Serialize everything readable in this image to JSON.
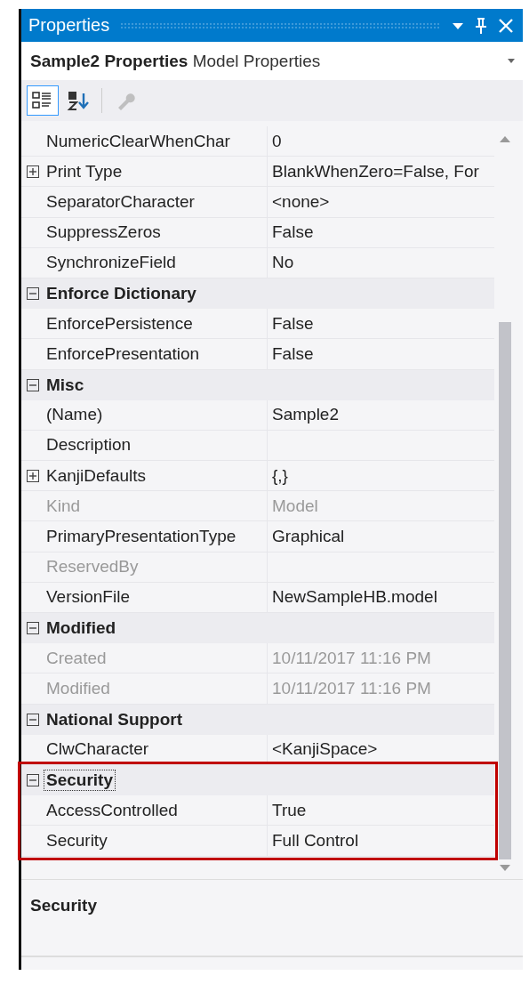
{
  "window": {
    "title": "Properties"
  },
  "object_selector": {
    "text": "**Sample2 Properties** Model Properties"
  },
  "toolbar": [
    {
      "kind": "categorized",
      "selected": true,
      "disabled": false
    },
    {
      "kind": "alphabetical",
      "selected": false,
      "disabled": false
    },
    {
      "kind": "property-pages",
      "selected": false,
      "disabled": true
    }
  ],
  "grid": {
    "sections": [
      {
        "properties": [
          {
            "name": "NumericClearWhenChar",
            "value": "0",
            "disabled": false
          },
          {
            "name": "Print Type",
            "value": "BlankWhenZero=False, For",
            "disabled": false,
            "expanded": false
          },
          {
            "name": "SeparatorCharacter",
            "value": "<none>",
            "disabled": false
          },
          {
            "name": "SuppressZeros",
            "value": "False",
            "disabled": false
          },
          {
            "name": "SynchronizeField",
            "value": "No",
            "disabled": false
          }
        ]
      },
      {
        "name": "Enforce Dictionary",
        "expanded": true,
        "selected": false,
        "highlighted": false,
        "properties": [
          {
            "name": "EnforcePersistence",
            "value": "False",
            "disabled": false
          },
          {
            "name": "EnforcePresentation",
            "value": "False",
            "disabled": false
          }
        ]
      },
      {
        "name": "Misc",
        "expanded": true,
        "selected": false,
        "highlighted": false,
        "properties": [
          {
            "name": "(Name)",
            "value": "Sample2",
            "disabled": false
          },
          {
            "name": "Description",
            "disabled": false
          },
          {
            "name": "KanjiDefaults",
            "value": "{,}",
            "disabled": false,
            "expanded": false
          },
          {
            "name": "Kind",
            "value": "Model",
            "disabled": true
          },
          {
            "name": "PrimaryPresentationType",
            "value": "Graphical",
            "disabled": false
          },
          {
            "name": "ReservedBy",
            "disabled": true
          },
          {
            "name": "VersionFile",
            "value": "NewSampleHB.model",
            "disabled": false
          }
        ]
      },
      {
        "name": "Modified",
        "expanded": true,
        "selected": false,
        "highlighted": false,
        "properties": [
          {
            "name": "Created",
            "value": "10/11/2017 11:16 PM",
            "disabled": true
          },
          {
            "name": "Modified",
            "value": "10/11/2017 11:16 PM",
            "disabled": true
          }
        ]
      },
      {
        "name": "National Support",
        "expanded": true,
        "selected": false,
        "highlighted": false,
        "properties": [
          {
            "name": "ClwCharacter",
            "value": "<KanjiSpace>",
            "disabled": false
          }
        ]
      },
      {
        "name": "Security",
        "expanded": true,
        "selected": true,
        "highlighted": true,
        "properties": [
          {
            "name": "AccessControlled",
            "value": "True",
            "disabled": false
          },
          {
            "name": "Security",
            "value": "Full Control",
            "disabled": false
          }
        ]
      }
    ]
  },
  "description_pane": {
    "title": "Security"
  }
}
